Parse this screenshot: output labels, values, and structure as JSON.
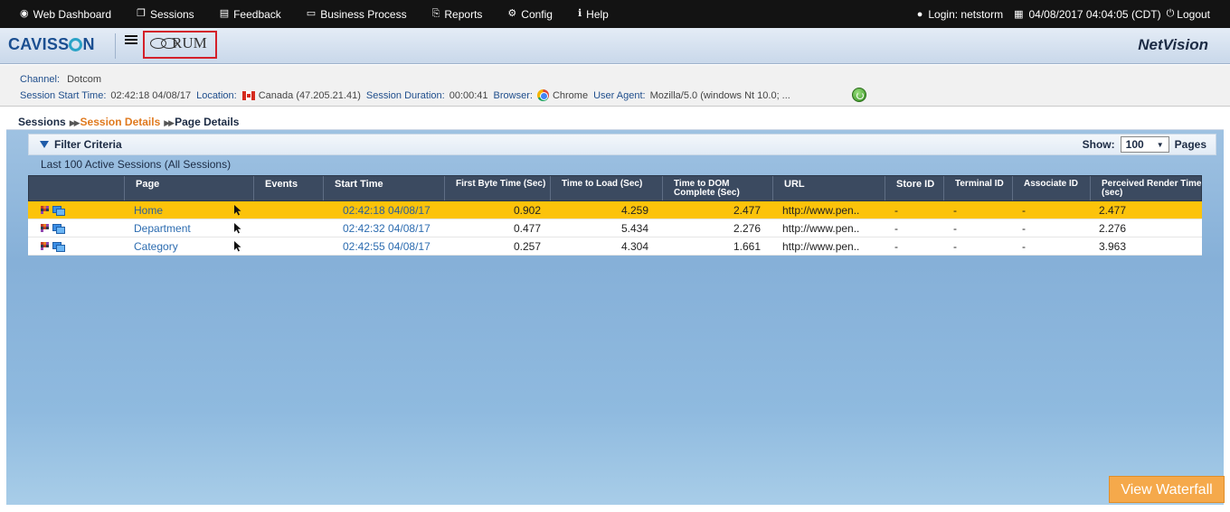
{
  "topnav": {
    "items": [
      {
        "label": "Web Dashboard",
        "icon": "dashboard-icon",
        "glyph": "◉"
      },
      {
        "label": "Sessions",
        "icon": "sessions-icon",
        "glyph": "❐"
      },
      {
        "label": "Feedback",
        "icon": "feedback-icon",
        "glyph": "▤"
      },
      {
        "label": "Business Process",
        "icon": "business-process-icon",
        "glyph": "▭"
      },
      {
        "label": "Reports",
        "icon": "reports-icon",
        "glyph": "⎘"
      },
      {
        "label": "Config",
        "icon": "config-icon",
        "glyph": "⚙"
      },
      {
        "label": "Help",
        "icon": "help-icon",
        "glyph": "ℹ"
      }
    ],
    "login": "Login: netstorm",
    "datetime": "04/08/2017 04:04:05 (CDT)",
    "logout": "Logout"
  },
  "header": {
    "logo_left": "CAVISS",
    "logo_right": "N",
    "rum_label": "RUM",
    "product": "NetVision"
  },
  "session_info": {
    "channel_label": "Channel:",
    "channel": "Dotcom",
    "start_time_label": "Session Start Time:",
    "start_time": "02:42:18 04/08/17",
    "location_label": "Location:",
    "location": "Canada (47.205.21.41)",
    "duration_label": "Session Duration:",
    "duration": "00:00:41",
    "browser_label": "Browser:",
    "browser": "Chrome",
    "user_agent_label": "User Agent:",
    "user_agent": "Mozilla/5.0 (windows Nt 10.0; ..."
  },
  "breadcrumb": {
    "sessions": "Sessions",
    "session_details": "Session Details",
    "page_details": "Page Details"
  },
  "filter": {
    "title": "Filter Criteria",
    "show_label": "Show:",
    "show_value": "100",
    "pages_label": "Pages"
  },
  "sessions_count": "Last 100 Active Sessions (All Sessions)",
  "table": {
    "headers": [
      "",
      "Page",
      "Events",
      "Start Time",
      "First Byte Time (Sec)",
      "Time to Load (Sec)",
      "Time to DOM Complete (Sec)",
      "URL",
      "Store ID",
      "Terminal ID",
      "Associate ID",
      "Perceived Render Time (sec)"
    ],
    "rows": [
      {
        "page": "Home",
        "start_time": "02:42:18 04/08/17",
        "first_byte": "0.902",
        "load": "4.259",
        "dom": "2.477",
        "url": "http://www.pen..",
        "store": "-",
        "terminal": "-",
        "associate": "-",
        "render": "2.477",
        "selected": true
      },
      {
        "page": "Department",
        "start_time": "02:42:32 04/08/17",
        "first_byte": "0.477",
        "load": "5.434",
        "dom": "2.276",
        "url": "http://www.pen..",
        "store": "-",
        "terminal": "-",
        "associate": "-",
        "render": "2.276",
        "selected": false
      },
      {
        "page": "Category",
        "start_time": "02:42:55 04/08/17",
        "first_byte": "0.257",
        "load": "4.304",
        "dom": "1.661",
        "url": "http://www.pen..",
        "store": "-",
        "terminal": "-",
        "associate": "-",
        "render": "3.963",
        "selected": false
      }
    ]
  },
  "view_waterfall": "View Waterfall",
  "colors": {
    "nav_bg": "#131313",
    "selected_row": "#fcc30a",
    "header_row": "#3b4a60",
    "accent_orange": "#e07a1f",
    "waterfall_button": "#f5a94b"
  }
}
